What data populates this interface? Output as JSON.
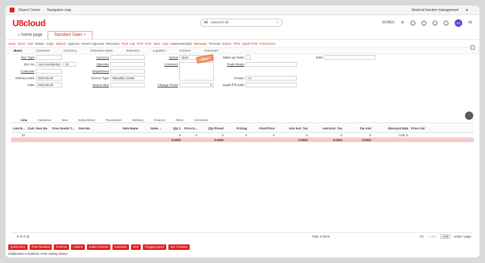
{
  "topbar": {
    "report_center": "Report Center",
    "nav_map": "Navigation map",
    "shortcut": "Shortcut function management"
  },
  "header": {
    "logo": "U8cloud",
    "search_scope": "All",
    "search_placeholder": "research all",
    "org": "SCMGC",
    "avatar": "A1",
    "avatar_name": "A1"
  },
  "tabs": [
    {
      "label": "home page"
    },
    {
      "label": "Standard Sales"
    }
  ],
  "toolbar": {
    "items": [
      {
        "label": "Save",
        "color": "red"
      },
      {
        "label": "Abort",
        "color": "red"
      },
      {
        "label": "Add",
        "color": "red"
      },
      {
        "label": "Delete",
        "color": "gray"
      },
      {
        "label": "Copy",
        "color": "gray"
      },
      {
        "label": "Submit",
        "color": "red"
      },
      {
        "label": "Approve",
        "color": "gray"
      },
      {
        "label": "Revert Approval",
        "color": "gray"
      },
      {
        "label": "Recovery",
        "color": "gray"
      },
      {
        "label": "Find",
        "color": "red"
      },
      {
        "label": "List",
        "color": "red"
      },
      {
        "label": "First",
        "color": "red"
      },
      {
        "label": "Prev",
        "color": "red"
      },
      {
        "label": "Next",
        "color": "red"
      },
      {
        "label": "Last",
        "color": "red"
      },
      {
        "label": "Attachments(0)",
        "color": "gray"
      },
      {
        "label": "Message",
        "color": "red"
      },
      {
        "label": "Process",
        "color": "gray"
      },
      {
        "label": "Export",
        "color": "red"
      },
      {
        "label": "Print",
        "color": "red"
      },
      {
        "label": "Quick Print",
        "color": "red"
      },
      {
        "label": "Full Screen",
        "color": "red"
      }
    ]
  },
  "subtabs": [
    "Basic",
    "Customer",
    "Currency",
    "Overseas Sales",
    "Business",
    "Logistics",
    "Finance",
    "Comment"
  ],
  "form": {
    "doc_type_label": "Doc Type",
    "doc_no_label": "Doc No",
    "doc_no_value": "Auto Numbering",
    "doc_no_suffix": "01",
    "customer_label": "Customer",
    "delivery_date_label": "Delivery Date",
    "delivery_date_value": "2023.05.25",
    "date_label": "Date",
    "date_value": "2023.05.25",
    "currency_label": "Currency",
    "operator_label": "Operator",
    "department_label": "Department",
    "source_type_label": "Source Type",
    "source_type_value": "Manually Create",
    "source_doc_label": "Source Doc",
    "status_label": "Status",
    "status_value": "Open",
    "comment_label": "Comment",
    "change_times_label": "Change Times",
    "change_times_value": "0",
    "makeup_label": "Make-up Order",
    "trade_route_label": "Trade Route",
    "creator_label": "Creator",
    "creator_value": "A1",
    "wgfe_label": "wxgfe卡片1000",
    "test2_label": "test2",
    "stamp": "Open"
  },
  "linetabs": [
    "Line",
    "Customer",
    "Item",
    "Subcontract",
    "Transaction",
    "Delivery",
    "Finance",
    "Other",
    "Comment"
  ],
  "grid": {
    "headers": [
      "Line N...",
      "Cust. Item No.",
      "Free Goods T...",
      "Item No.",
      "Item Name",
      "Sales ...",
      "Qty 1",
      "Price U...",
      "Qty Priced",
      "Pricing",
      "Final Price",
      "Amt Incl. Tax",
      "Amt Excl. Tax",
      "Tax Amt",
      "Discount Rate",
      "Price List"
    ],
    "row": [
      "10",
      "",
      "",
      "",
      "",
      "",
      "0",
      "0",
      "0",
      "0",
      "0",
      "0",
      "0",
      "0",
      "0.00 %",
      ""
    ],
    "total": [
      "",
      "",
      "",
      "",
      "",
      "",
      "0.0000",
      "",
      "0.0000",
      "",
      "",
      "0.0000",
      "0.0000",
      "0.0000",
      "",
      ""
    ]
  },
  "footer": {
    "total": "Total: 0 items",
    "pager": "1/1",
    "per_page": "Article / page",
    "page_size": "1000"
  },
  "actions": [
    "Quick Entry",
    "Price Recalcul",
    "Reserve",
    "Actions",
    "Subsq Process",
    "Customer",
    "Item",
    "Pegging Query",
    "Rel. Function"
  ],
  "status_text": "Initialization completed, enter Adding status!"
}
